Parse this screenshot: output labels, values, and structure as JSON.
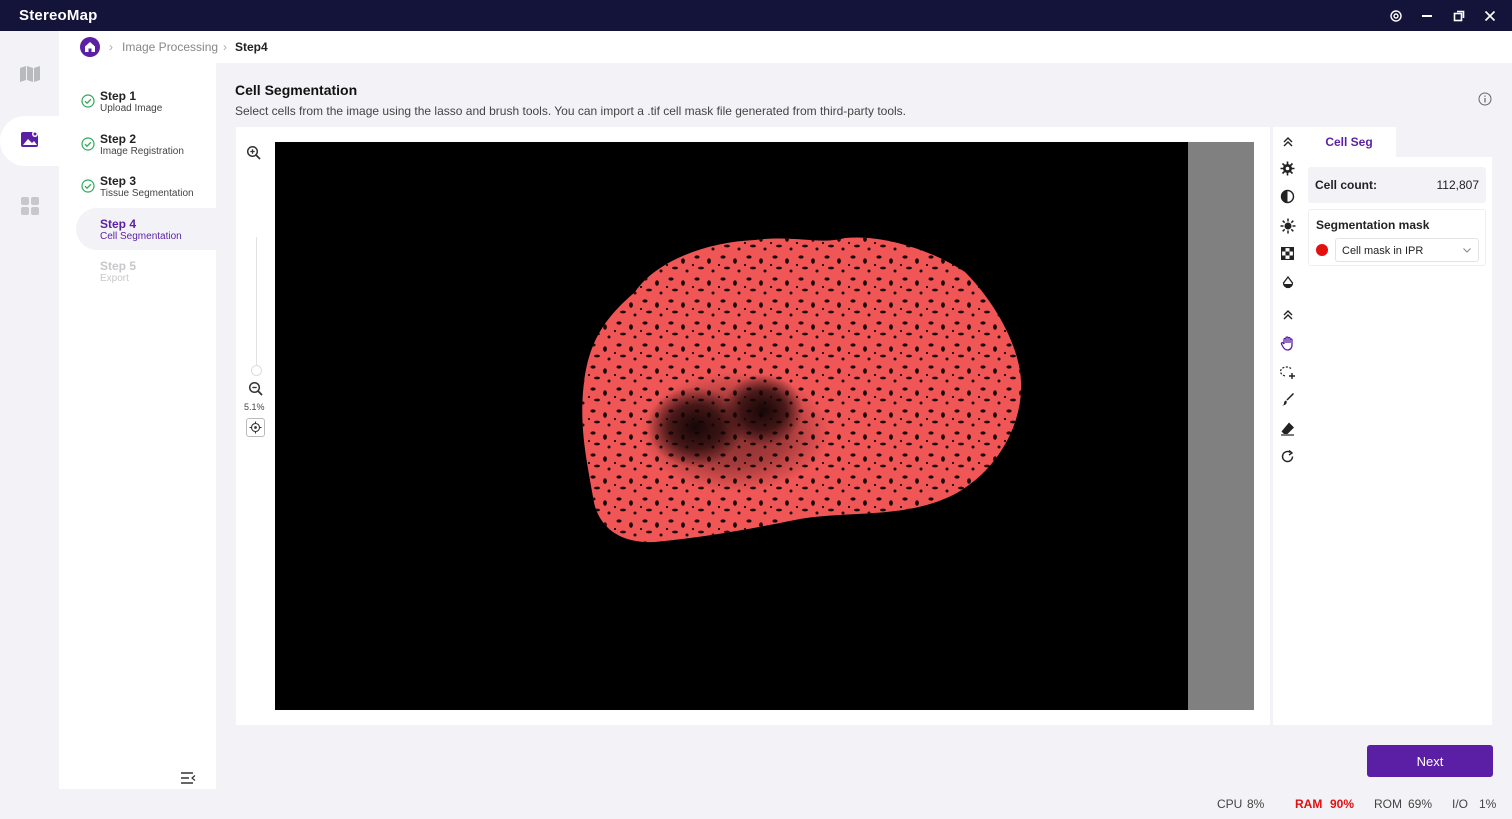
{
  "app": {
    "title": "StereoMap"
  },
  "breadcrumb": {
    "section": "Image Processing",
    "current": "Step4"
  },
  "rail": {
    "items": [
      {
        "icon": "map-icon"
      },
      {
        "icon": "image-processing-icon",
        "active": true
      },
      {
        "icon": "apps-grid-icon"
      }
    ]
  },
  "steps": [
    {
      "title": "Step 1",
      "desc": "Upload Image",
      "state": "done"
    },
    {
      "title": "Step 2",
      "desc": "Image Registration",
      "state": "done"
    },
    {
      "title": "Step 3",
      "desc": "Tissue Segmentation",
      "state": "done"
    },
    {
      "title": "Step 4",
      "desc": "Cell Segmentation",
      "state": "active"
    },
    {
      "title": "Step 5",
      "desc": "Export",
      "state": "disabled"
    }
  ],
  "page": {
    "title": "Cell Segmentation",
    "description": "Select cells from the image using the lasso and brush tools. You can import a .tif cell mask file generated from third-party tools."
  },
  "zoom": {
    "percent": "5.1%",
    "level": 0.05
  },
  "panel": {
    "tab": "Cell Seg",
    "cell_count_label": "Cell count:",
    "cell_count_value": "112,807",
    "mask_label": "Segmentation mask",
    "mask_value": "Cell mask in IPR",
    "mask_color": "#e41010"
  },
  "actions": {
    "next": "Next"
  },
  "status": {
    "cpu_label": "CPU",
    "cpu_value": "8%",
    "ram_label": "RAM",
    "ram_value": "90%",
    "rom_label": "ROM",
    "rom_value": "69%",
    "io_label": "I/O",
    "io_value": "1%"
  },
  "colors": {
    "accent": "#5b1fa6",
    "titlebar": "#14133a",
    "tissue": "#f05656",
    "warning": "#e41010"
  }
}
